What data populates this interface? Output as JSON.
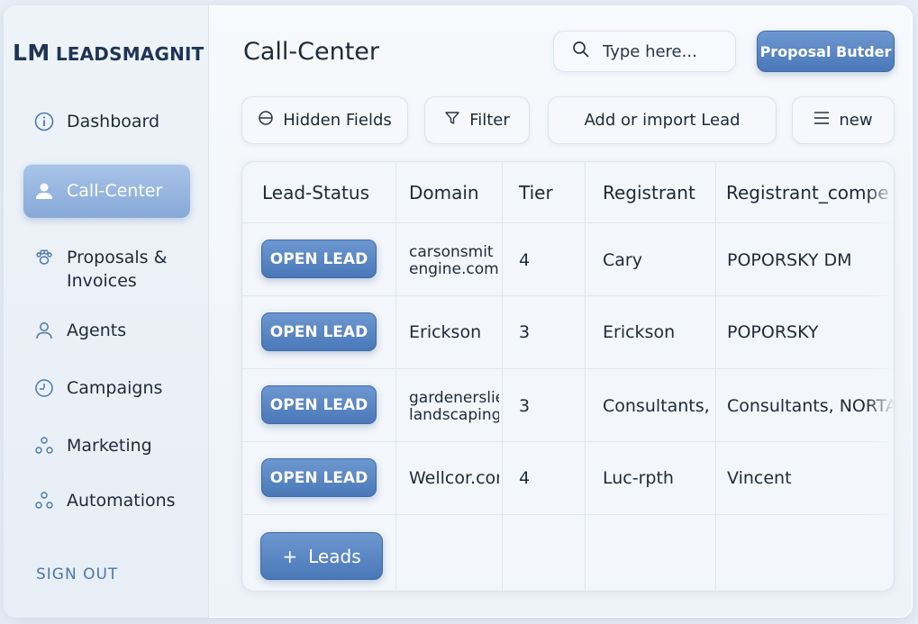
{
  "brand": {
    "mark": "LM",
    "name": "LEADSMAGNIT"
  },
  "sidebar": {
    "items": [
      {
        "label": "Dashboard",
        "icon": "info-circle-icon"
      },
      {
        "label": "Call-Center",
        "icon": "user-icon",
        "active": true
      },
      {
        "label": "Proposals &\nInvoices",
        "label_line1": "Proposals &",
        "label_line2": "Invoices",
        "icon": "paw-icon"
      },
      {
        "label": "Agents",
        "icon": "person-icon"
      },
      {
        "label": "Campaigns",
        "icon": "clock-icon"
      },
      {
        "label": "Marketing",
        "icon": "dots-icon"
      },
      {
        "label": "Automations",
        "icon": "dots-icon"
      }
    ],
    "signout_label": "SIGN OUT"
  },
  "header": {
    "title": "Call-Center",
    "search_placeholder": "Type here...",
    "proposal_button": "Proposal Butder"
  },
  "toolbar": {
    "hidden_fields": "Hidden Fields",
    "filter": "Filter",
    "add_import": "Add or import Lead",
    "new": "new"
  },
  "table": {
    "columns": [
      "Lead-Status",
      "Domain",
      "Tier",
      "Registrant",
      "Registrant_compe"
    ],
    "rows": [
      {
        "status": "OPEN LEAD",
        "domain_line1": "carsonsmit",
        "domain_line2": "engine.com",
        "tier": "4",
        "registrant": "Cary",
        "company": "POPORSKY DM"
      },
      {
        "status": "OPEN LEAD",
        "domain_line1": "Erickson",
        "domain_line2": "",
        "tier": "3",
        "registrant": "Erickson",
        "company": "POPORSKY"
      },
      {
        "status": "OPEN LEAD",
        "domain_line1": "gardenerslie",
        "domain_line2": "landscaping",
        "tier": "3",
        "registrant": "Consultants,",
        "company": "Consultants, NORTA"
      },
      {
        "status": "OPEN LEAD",
        "domain_line1": "Wellcor.con",
        "domain_line2": "",
        "tier": "4",
        "registrant": "Luc-rpth",
        "company": "Vincent"
      }
    ],
    "add_leads_label": "Leads",
    "add_leads_symbol": "+"
  },
  "colors": {
    "accent": "#4a78b8",
    "accent_light": "#86a9d8",
    "signout": "#4a78a8"
  }
}
